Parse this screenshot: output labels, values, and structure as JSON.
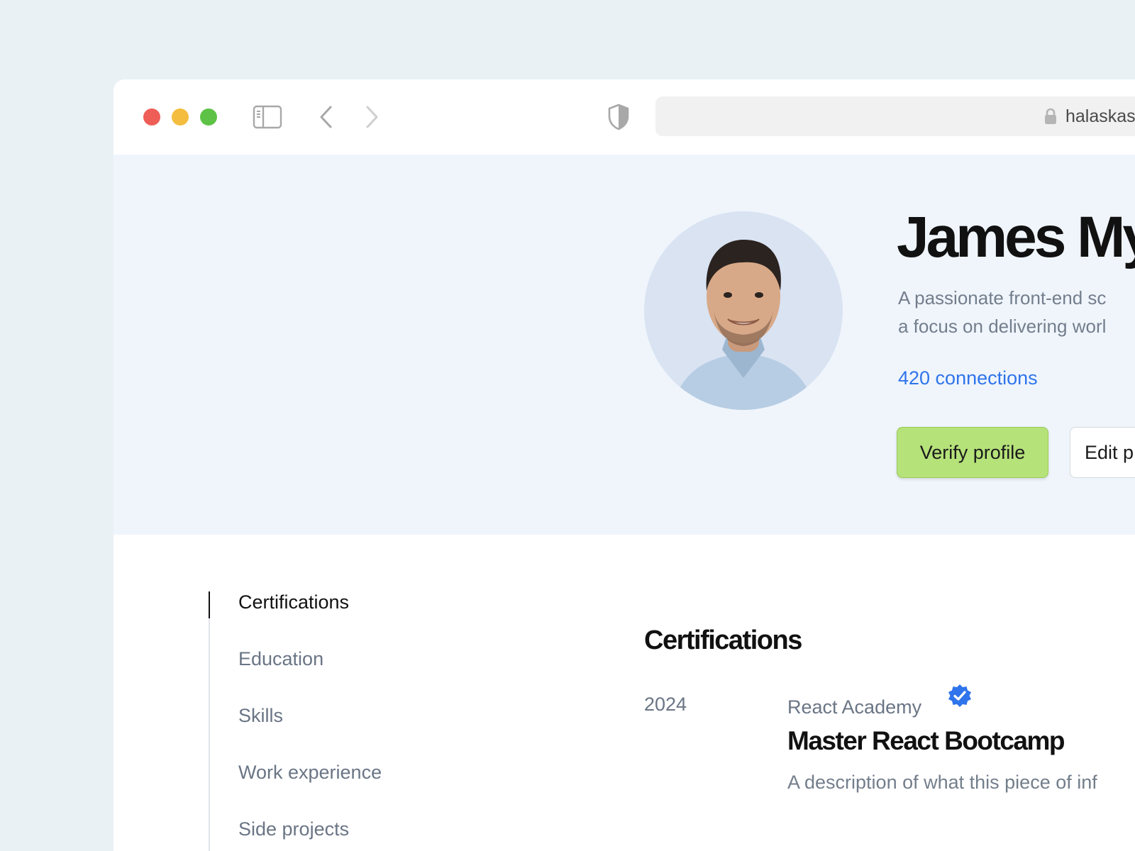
{
  "browser": {
    "url": "halaskastudio.com",
    "icons": [
      "sidebar-toggle-icon",
      "chevron-left-icon",
      "chevron-right-icon",
      "shield-icon",
      "lock-icon"
    ]
  },
  "profile": {
    "name": "James My",
    "bio_lines": [
      "A passionate front-end sc",
      "a focus on delivering worl"
    ],
    "connections": "420 connections",
    "verify_label": "Verify profile",
    "edit_label": "Edit p"
  },
  "nav": {
    "items": [
      {
        "label": "Certifications",
        "active": true
      },
      {
        "label": "Education",
        "active": false
      },
      {
        "label": "Skills",
        "active": false
      },
      {
        "label": "Work experience",
        "active": false
      },
      {
        "label": "Side projects",
        "active": false
      }
    ]
  },
  "certifications": {
    "title": "Certifications",
    "entries": [
      {
        "year": "2024",
        "issuer": "React Academy",
        "title": "Master React Bootcamp",
        "description": "A description of what this piece of inf",
        "verified": true
      }
    ]
  },
  "colors": {
    "accent_link": "#2F74EB",
    "verify_button": "#B6E27A",
    "hero_background": "#F0F5FC",
    "page_background": "#EAF1F5"
  }
}
